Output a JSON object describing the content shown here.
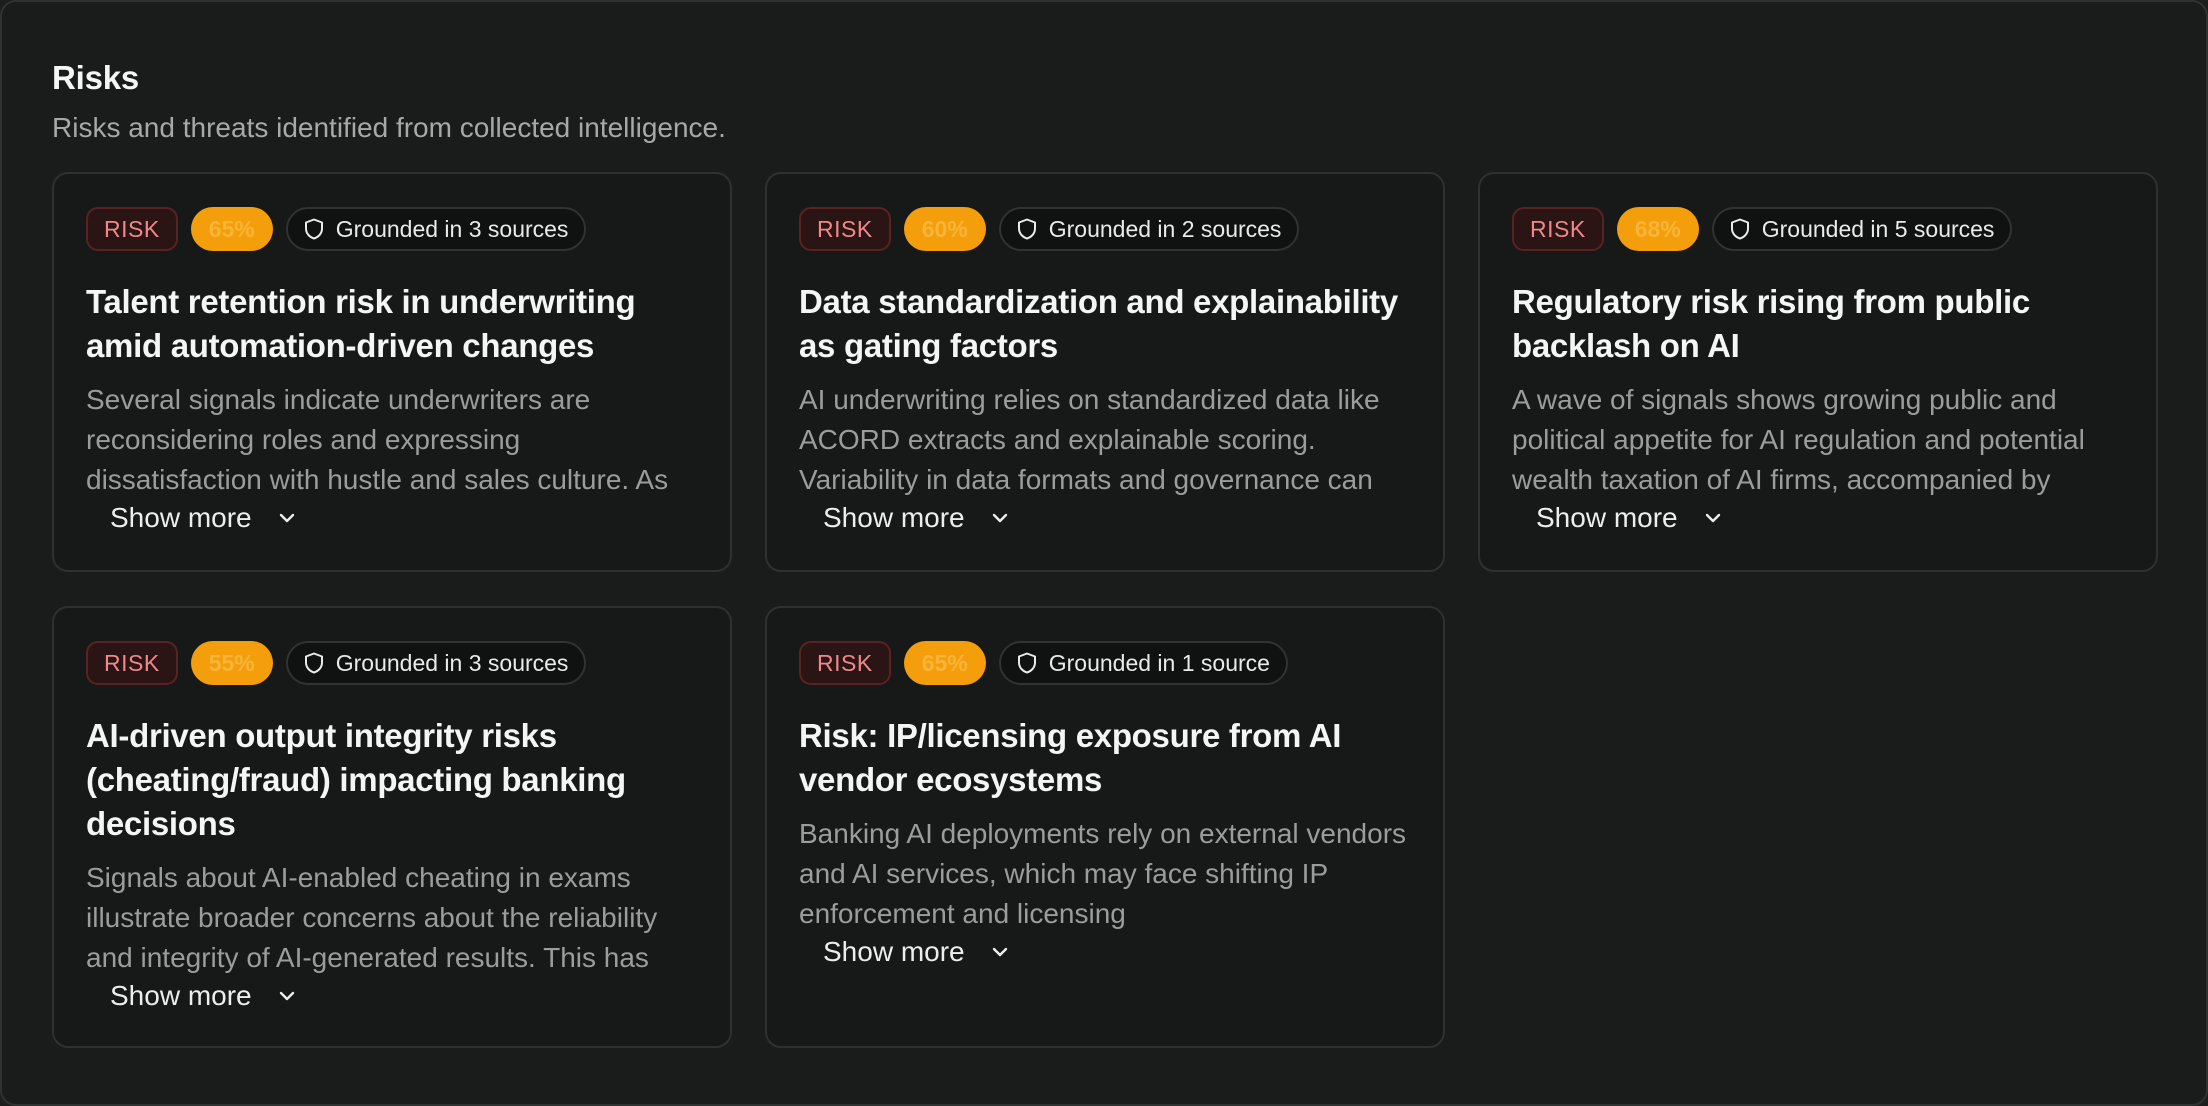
{
  "header": {
    "title": "Risks",
    "subtitle": "Risks and threats identified from collected intelligence."
  },
  "colors": {
    "risk_badge_text": "#f0878a",
    "risk_badge_bg": "#2a1414",
    "confidence_badge_bg": "#f59e0b",
    "background": "#1a1c1b"
  },
  "show_more_label": "Show more",
  "cards": [
    {
      "badge": "RISK",
      "confidence": "65%",
      "grounded": "Grounded in 3 sources",
      "title": "Talent retention risk in underwriting amid automation-driven changes",
      "body": "Several signals indicate underwriters are reconsidering roles and expressing dissatisfaction with hustle and sales culture. As"
    },
    {
      "badge": "RISK",
      "confidence": "60%",
      "grounded": "Grounded in 2 sources",
      "title": "Data standardization and explainability as gating factors",
      "body": "AI underwriting relies on standardized data like ACORD extracts and explainable scoring. Variability in data formats and governance can"
    },
    {
      "badge": "RISK",
      "confidence": "68%",
      "grounded": "Grounded in 5 sources",
      "title": "Regulatory risk rising from public backlash on AI",
      "body": "A wave of signals shows growing public and political appetite for AI regulation and potential wealth taxation of AI firms, accompanied by"
    },
    {
      "badge": "RISK",
      "confidence": "55%",
      "grounded": "Grounded in 3 sources",
      "title": "AI-driven output integrity risks (cheating/fraud) impacting banking decisions",
      "body": "Signals about AI-enabled cheating in exams illustrate broader concerns about the reliability and integrity of AI-generated results. This has"
    },
    {
      "badge": "RISK",
      "confidence": "65%",
      "grounded": "Grounded in 1 source",
      "title": "Risk: IP/licensing exposure from AI vendor ecosystems",
      "body": "Banking AI deployments rely on external vendors and AI services, which may face shifting IP enforcement and licensing"
    }
  ]
}
